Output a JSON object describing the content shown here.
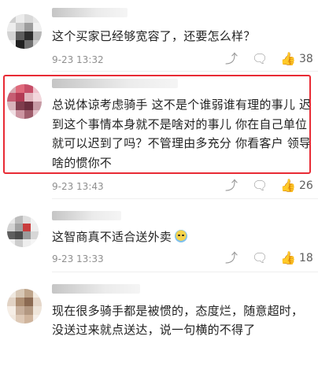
{
  "comments": [
    {
      "text": "这个买家已经够宽容了，还要怎么样？",
      "time": "9-23 13:32",
      "likes": "38",
      "icons": {
        "share": "share-icon",
        "reply": "reply-icon",
        "like": "thumb-up-icon"
      }
    },
    {
      "text": "总说体谅考虑骑手 这不是个谁弱谁有理的事儿 迟到这个事情本身就不是啥对的事儿 你在自己单位就可以迟到了吗？不管理由多充分 你看客户 领导啥的惯你不",
      "time": "9-23 13:43",
      "likes": "26",
      "icons": {
        "share": "share-icon",
        "reply": "reply-icon",
        "like": "thumb-up-icon"
      }
    },
    {
      "text": "这智商真不适合送外卖",
      "time": "9-23 13:33",
      "likes": "18",
      "emoji": "sweat-smile-emoji",
      "icons": {
        "share": "share-icon",
        "reply": "reply-icon",
        "like": "thumb-up-icon"
      }
    },
    {
      "text": "现在很多骑手都是被惯的，态度烂，随意超时，没送过来就点送达，说一句横的不得了",
      "icons": {}
    }
  ],
  "colors": {
    "highlight": "#e82b35",
    "meta": "#8f8f8f",
    "text": "#222222"
  }
}
